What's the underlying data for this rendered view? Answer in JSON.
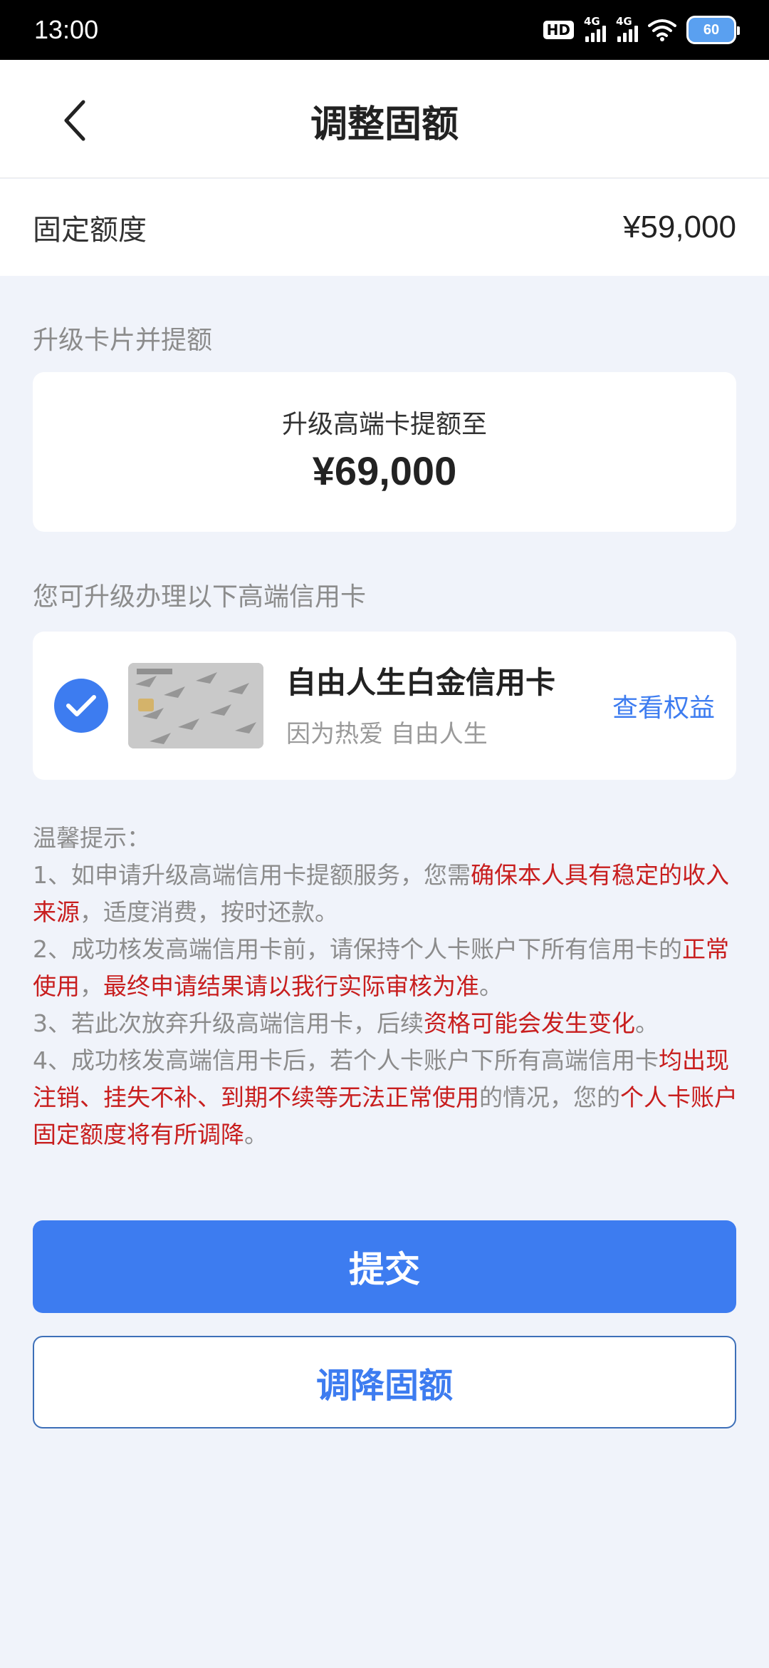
{
  "status_bar": {
    "time": "13:00",
    "hd_label": "HD",
    "network_1": "4G",
    "network_2": "4G",
    "battery": "60"
  },
  "header": {
    "title": "调整固额"
  },
  "fixed_limit": {
    "label": "固定额度",
    "value": "¥59,000"
  },
  "upgrade_section": {
    "label": "升级卡片并提额",
    "card_subtitle": "升级高端卡提额至",
    "card_amount": "¥69,000"
  },
  "card_section": {
    "label": "您可升级办理以下高端信用卡",
    "card_name": "自由人生白金信用卡",
    "card_slogan": "因为热爱 自由人生",
    "benefits_link": "查看权益",
    "selected": true
  },
  "tips": {
    "title": "温馨提示：",
    "items": [
      [
        {
          "t": "1、如申请升级高端信用卡提额服务，您需",
          "red": false
        },
        {
          "t": "确保本人具有稳定的收入来源",
          "red": true
        },
        {
          "t": "，适度消费，按时还款。",
          "red": false
        }
      ],
      [
        {
          "t": "2、成功核发高端信用卡前，请保持个人卡账户下所有信用卡的",
          "red": false
        },
        {
          "t": "正常使用",
          "red": true
        },
        {
          "t": "，",
          "red": false
        },
        {
          "t": "最终申请结果请以我行实际审核为准",
          "red": true
        },
        {
          "t": "。",
          "red": false
        }
      ],
      [
        {
          "t": "3、若此次放弃升级高端信用卡，后续",
          "red": false
        },
        {
          "t": "资格可能会发生变化",
          "red": true
        },
        {
          "t": "。",
          "red": false
        }
      ],
      [
        {
          "t": "4、成功核发高端信用卡后，若个人卡账户下所有高端信用卡",
          "red": false
        },
        {
          "t": "均出现注销、挂失不补、到期不续等无法正常使用",
          "red": true
        },
        {
          "t": "的情况，您的",
          "red": false
        },
        {
          "t": "个人卡账户固定额度将有所调降",
          "red": true
        },
        {
          "t": "。",
          "red": false
        }
      ]
    ]
  },
  "buttons": {
    "submit": "提交",
    "reduce": "调降固额"
  },
  "colors": {
    "accent": "#3d7cf0",
    "warning": "#c81e1e",
    "background": "#f0f3fa"
  }
}
